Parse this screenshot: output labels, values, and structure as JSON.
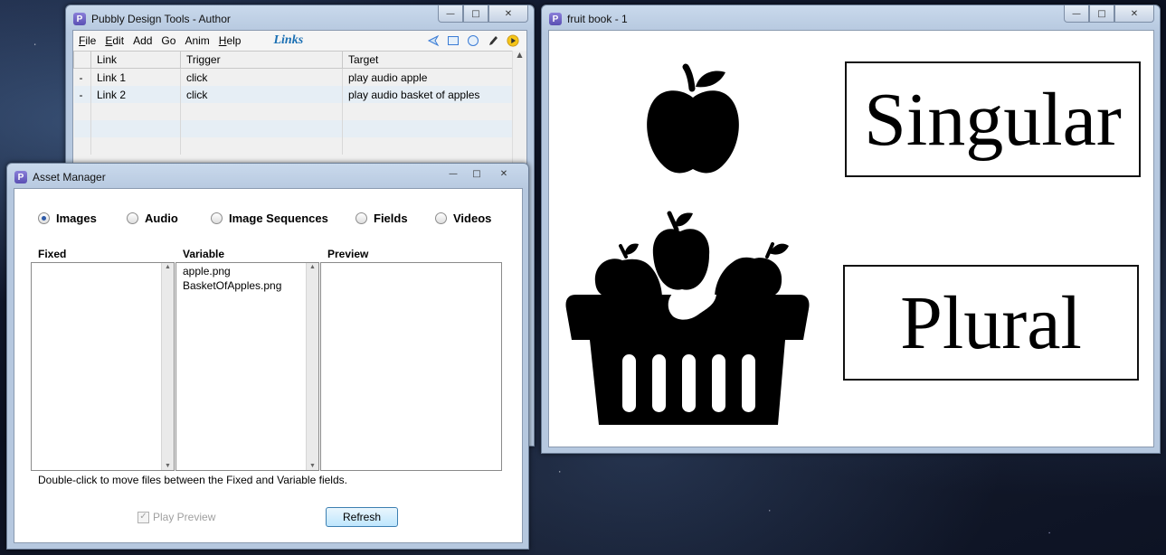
{
  "author": {
    "title": "Pubbly Design Tools - Author",
    "menu": [
      {
        "first": "F",
        "rest": "ile"
      },
      {
        "first": "E",
        "rest": "dit"
      },
      {
        "first": "",
        "rest": "Add"
      },
      {
        "first": "",
        "rest": "Go"
      },
      {
        "first": "",
        "rest": "Anim"
      },
      {
        "first": "H",
        "rest": "elp"
      }
    ],
    "mode": "Links",
    "table": {
      "headers": [
        "",
        "Link",
        "Trigger",
        "Target"
      ],
      "rows": [
        {
          "dash": "-",
          "link": "Link 1",
          "trigger": "click",
          "target": "play audio apple"
        },
        {
          "dash": "-",
          "link": "Link 2",
          "trigger": "click",
          "target": "play audio basket of apples"
        }
      ]
    }
  },
  "asset_manager": {
    "title": "Asset Manager",
    "radios": [
      {
        "label": "Images",
        "selected": true
      },
      {
        "label": "Audio",
        "selected": false
      },
      {
        "label": "Image Sequences",
        "selected": false
      },
      {
        "label": "Fields",
        "selected": false
      },
      {
        "label": "Videos",
        "selected": false
      }
    ],
    "columns": {
      "fixed": "Fixed",
      "variable": "Variable",
      "preview": "Preview"
    },
    "variable_items": [
      "apple.png",
      "BasketOfApples.png"
    ],
    "hint": "Double-click to move files between the Fixed and Variable fields.",
    "play_preview": "Play Preview",
    "refresh": "Refresh"
  },
  "book": {
    "title": "fruit book - 1",
    "singular": "Singular",
    "plural": "Plural"
  },
  "window_controls": {
    "minimize": "—",
    "maximize": "□",
    "close": "✕"
  }
}
